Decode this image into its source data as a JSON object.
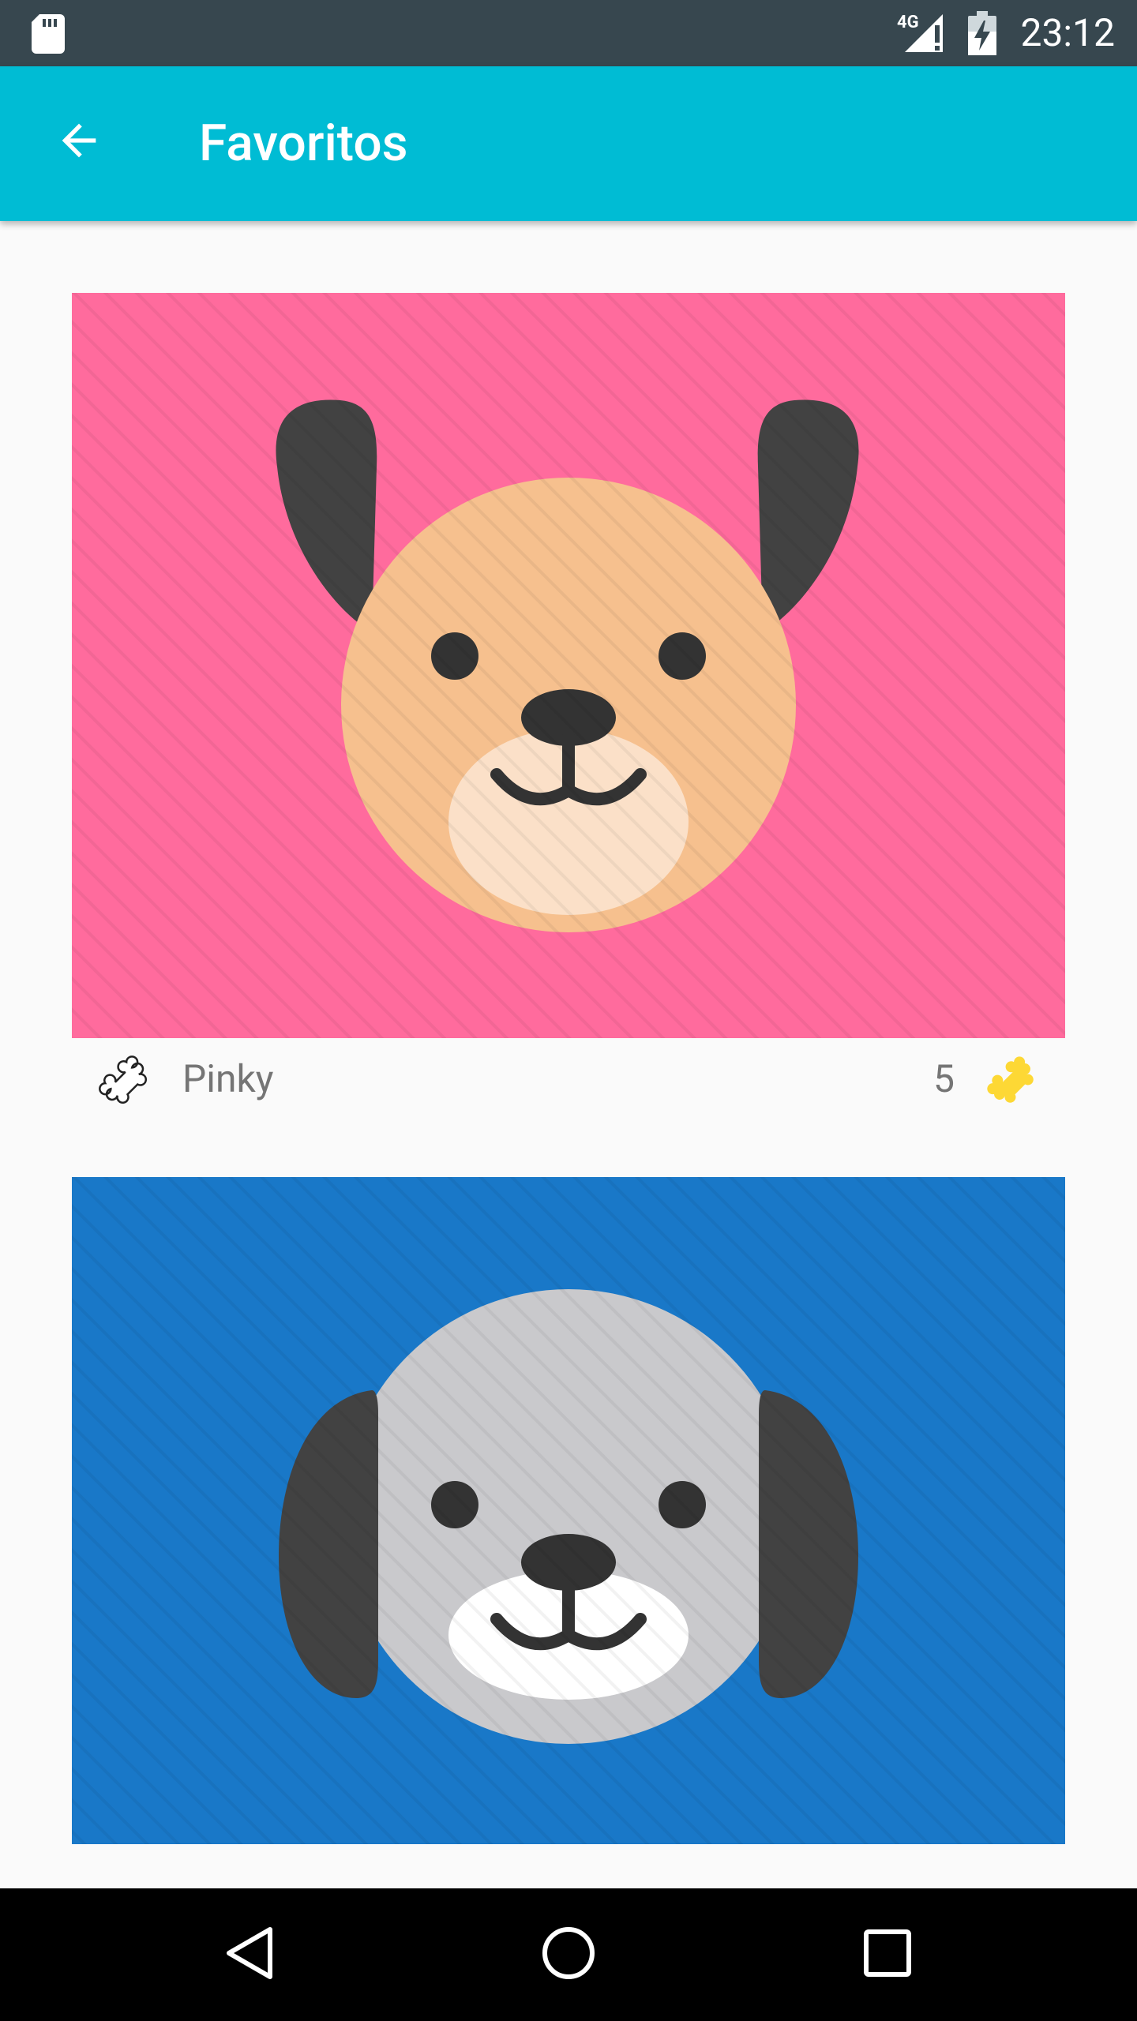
{
  "status_bar": {
    "time": "23:12",
    "network": "4G",
    "icons": [
      "sd-card-icon",
      "signal-icon",
      "battery-icon"
    ]
  },
  "app_bar": {
    "title": "Favoritos",
    "back_icon": "arrow-back-icon",
    "color": "#00bcd4"
  },
  "favorites": [
    {
      "name": "Pinky",
      "count": "5",
      "background": "#ff6b9d",
      "face": "#f6c08e",
      "ears": "#424242",
      "muzzle": "#fbe0c8"
    },
    {
      "name": "",
      "count": "",
      "background": "#1978c8",
      "face": "#c9c9cc",
      "ears": "#424242",
      "muzzle": "#ffffff"
    }
  ],
  "nav_bar": {
    "icons": [
      "nav-back-icon",
      "nav-home-icon",
      "nav-recents-icon"
    ]
  },
  "colors": {
    "status_bar": "#37474f",
    "accent": "#00bcd4",
    "bone_filled": "#fdd835",
    "text_secondary": "#757575"
  }
}
